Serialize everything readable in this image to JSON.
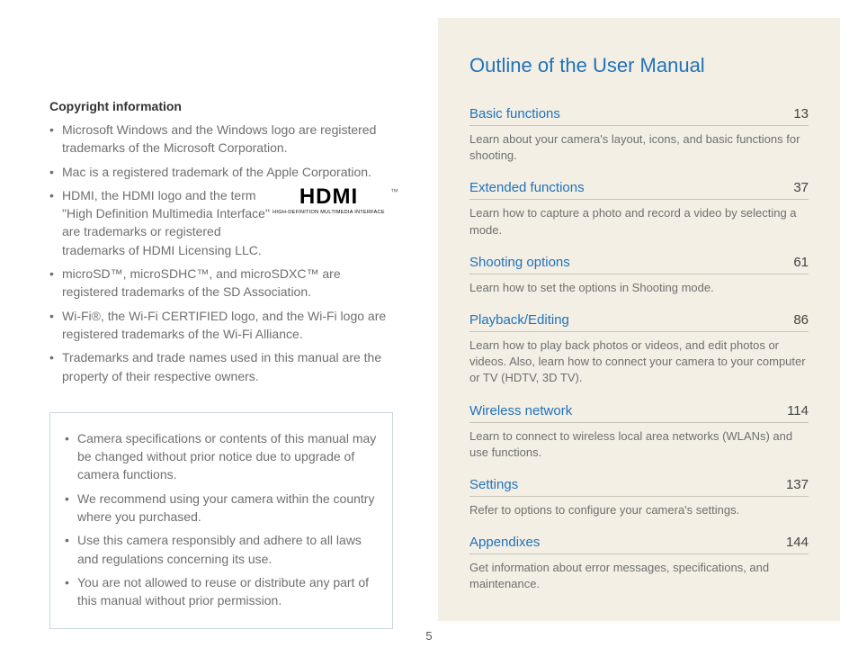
{
  "page_number": "5",
  "left": {
    "heading": "Copyright information",
    "bullets": [
      "Microsoft Windows and the Windows logo are registered trademarks of the Microsoft Corporation.",
      "Mac is a registered trademark of the Apple Corporation.",
      "HDMI, the HDMI logo and the term \"High Definition Multimedia Interface\" are trademarks or registered trademarks of HDMI Licensing LLC.",
      "microSD™, microSDHC™, and microSDXC™ are registered trademarks of the SD Association.",
      "Wi-Fi®, the Wi-Fi CERTIFIED logo, and the Wi-Fi logo are registered trademarks of the Wi-Fi Alliance.",
      "Trademarks and trade names used in this manual are the property of their respective owners."
    ],
    "hdmi_logo": {
      "text": "HDMI",
      "tm": "™",
      "subtitle": "HIGH-DEFINITION MULTIMEDIA INTERFACE"
    },
    "notice": [
      "Camera specifications or contents of this manual may be changed without prior notice due to upgrade of camera functions.",
      "We recommend using your camera within the country where you purchased.",
      "Use this camera responsibly and adhere to all laws and regulations concerning its use.",
      "You are not allowed to reuse or distribute any part of this manual without prior permission."
    ]
  },
  "right": {
    "title": "Outline of the User Manual",
    "sections": [
      {
        "title": "Basic functions",
        "page": "13",
        "desc": "Learn about your camera's layout, icons, and basic functions for shooting."
      },
      {
        "title": "Extended functions",
        "page": "37",
        "desc": "Learn how to capture a photo and record a video by selecting a mode."
      },
      {
        "title": "Shooting options",
        "page": "61",
        "desc": "Learn how to set the options in Shooting mode."
      },
      {
        "title": "Playback/Editing",
        "page": "86",
        "desc": "Learn how to play back photos or videos, and edit photos or videos. Also, learn how to connect your camera to your computer or TV (HDTV, 3D TV)."
      },
      {
        "title": "Wireless network",
        "page": "114",
        "desc": "Learn to connect to wireless local area networks (WLANs) and use functions."
      },
      {
        "title": "Settings",
        "page": "137",
        "desc": "Refer to options to configure your camera's settings."
      },
      {
        "title": "Appendixes",
        "page": "144",
        "desc": "Get information about error messages, specifications, and maintenance."
      }
    ]
  }
}
